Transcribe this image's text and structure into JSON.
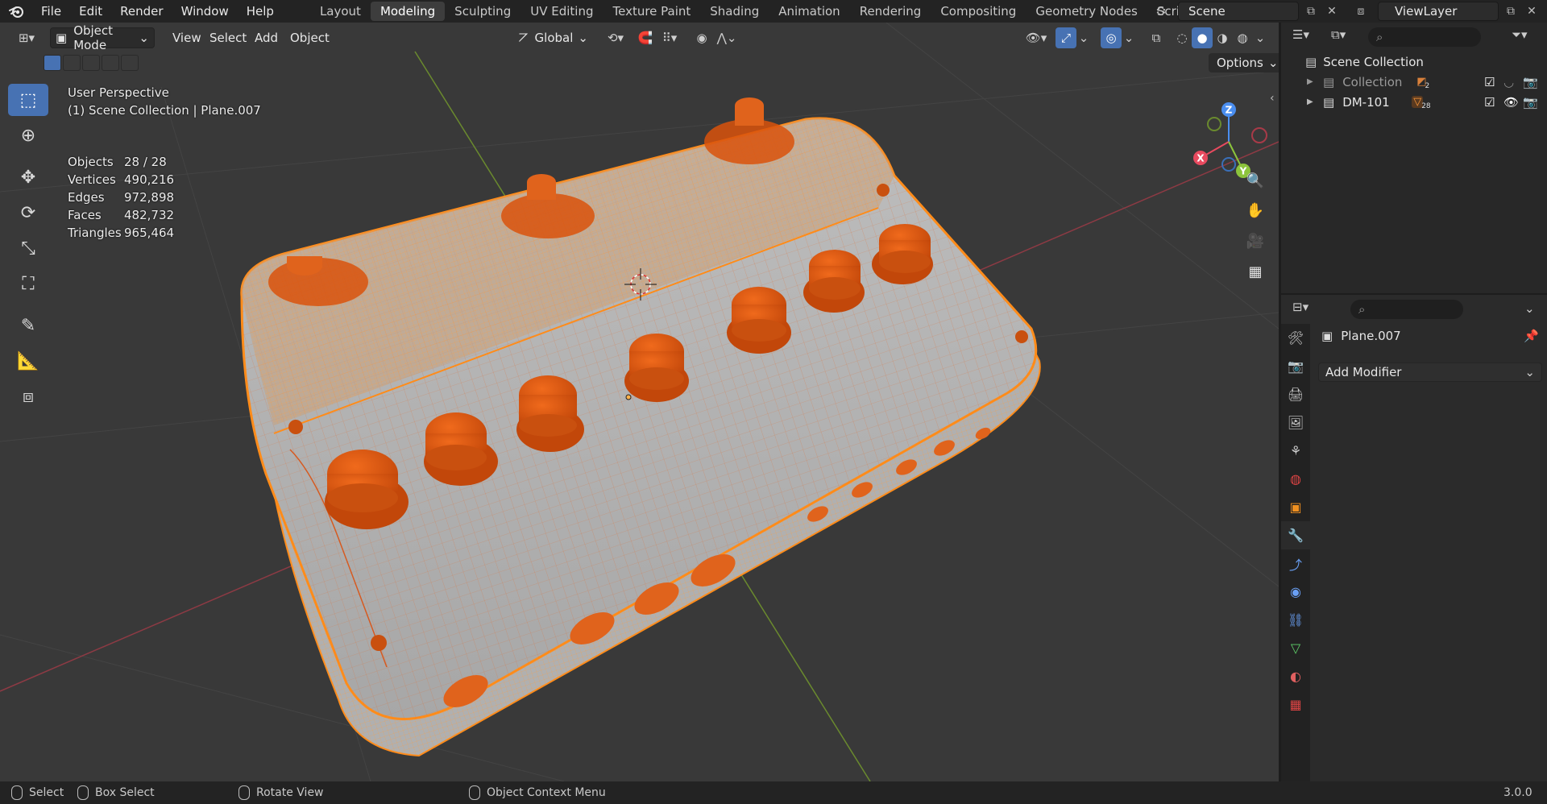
{
  "app": {
    "version": "3.0.0"
  },
  "menu": [
    "File",
    "Edit",
    "Render",
    "Window",
    "Help"
  ],
  "workspaces": [
    {
      "label": "Layout",
      "active": false
    },
    {
      "label": "Modeling",
      "active": true
    },
    {
      "label": "Sculpting",
      "active": false
    },
    {
      "label": "UV Editing",
      "active": false
    },
    {
      "label": "Texture Paint",
      "active": false
    },
    {
      "label": "Shading",
      "active": false
    },
    {
      "label": "Animation",
      "active": false
    },
    {
      "label": "Rendering",
      "active": false
    },
    {
      "label": "Compositing",
      "active": false
    },
    {
      "label": "Geometry Nodes",
      "active": false
    },
    {
      "label": "Scripting",
      "active": false
    }
  ],
  "scene": {
    "name": "Scene",
    "view_layer": "ViewLayer"
  },
  "viewport_header": {
    "mode": "Object Mode",
    "menus": [
      "View",
      "Select",
      "Add",
      "Object"
    ],
    "transform_orientation": "Global",
    "options_label": "Options"
  },
  "overlay": {
    "perspective": "User Perspective",
    "context": "(1) Scene Collection | Plane.007",
    "stats": [
      {
        "key": "Objects",
        "value": "28 / 28"
      },
      {
        "key": "Vertices",
        "value": "490,216"
      },
      {
        "key": "Edges",
        "value": "972,898"
      },
      {
        "key": "Faces",
        "value": "482,732"
      },
      {
        "key": "Triangles",
        "value": "965,464"
      }
    ]
  },
  "gizmo": {
    "x": "X",
    "y": "Y",
    "z": "Z"
  },
  "outliner": {
    "root": "Scene Collection",
    "items": [
      {
        "label": "Collection",
        "badge": "2"
      },
      {
        "label": "DM-101",
        "badge": "28"
      }
    ]
  },
  "properties": {
    "object_name": "Plane.007",
    "add_modifier": "Add Modifier"
  },
  "statusbar": {
    "select": "Select",
    "box_select": "Box Select",
    "rotate_view": "Rotate View",
    "context_menu": "Object Context Menu"
  },
  "colors": {
    "accent": "#4772b3",
    "selected_orange": "#ff8c1a",
    "knob_orange": "#d9520c",
    "viewport_bg": "#393939",
    "axis_x": "#e84a5f",
    "axis_y": "#8cc43c",
    "axis_z": "#4a8ef0"
  }
}
